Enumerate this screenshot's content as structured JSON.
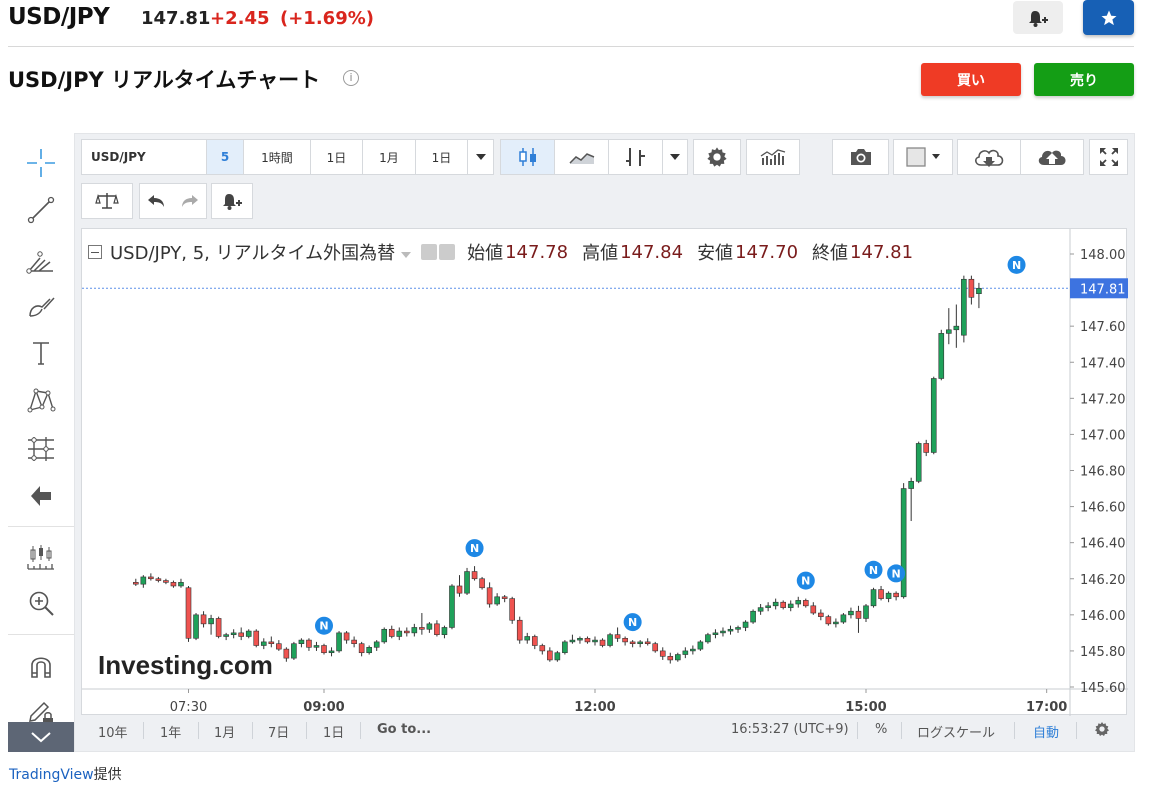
{
  "header": {
    "symbol": "USD/JPY",
    "price": "147.81",
    "change": "+2.45",
    "change_pct": "(+1.69%)"
  },
  "page_title": "USD/JPY リアルタイムチャート",
  "buttons": {
    "buy": "買い",
    "sell": "売り"
  },
  "toolbar": {
    "symbol": "USD/JPY",
    "interval": "5",
    "timeframes": [
      "1時間",
      "1日",
      "1月",
      "1日"
    ]
  },
  "legend": {
    "title": "USD/JPY, 5, リアルタイム外国為替",
    "open_label": "始値",
    "open": "147.78",
    "high_label": "高値",
    "high": "147.84",
    "low_label": "安値",
    "low": "147.70",
    "close_label": "終値",
    "close": "147.81"
  },
  "watermark": "Investing.com",
  "bottom_bar": {
    "ranges": [
      "10年",
      "1年",
      "1月",
      "7日",
      "1日"
    ],
    "goto": "Go to...",
    "clock": "16:53:27 (UTC+9)",
    "percent": "%",
    "log_scale": "ログスケール",
    "auto": "自動"
  },
  "credit": {
    "brand": "TradingView",
    "suffix": "提供"
  },
  "colors": {
    "up": "#26a69a",
    "up_fill": "#1fa15a",
    "down": "#ef5350",
    "accent_blue": "#1760b5",
    "last_price_tag": "#3d73e0"
  },
  "chart_data": {
    "type": "candlestick",
    "interval_minutes": 5,
    "y_ticks": [
      "148.00",
      "147.80",
      "147.60",
      "147.40",
      "147.20",
      "147.00",
      "146.80",
      "146.60",
      "146.40",
      "146.20",
      "146.00",
      "145.80",
      "145.60"
    ],
    "ylim": [
      145.55,
      148.1
    ],
    "x_ticks": [
      "07:30",
      "09:00",
      "12:00",
      "15:00",
      "17:00"
    ],
    "last_price": "147.81",
    "news_markers_times": [
      "09:00",
      "10:40",
      "12:25",
      "14:20",
      "15:05",
      "15:20",
      "16:40"
    ],
    "candles": [
      {
        "t": "06:55",
        "o": 146.18,
        "h": 146.2,
        "l": 146.16,
        "c": 146.17
      },
      {
        "t": "07:00",
        "o": 146.17,
        "h": 146.22,
        "l": 146.15,
        "c": 146.21
      },
      {
        "t": "07:05",
        "o": 146.21,
        "h": 146.23,
        "l": 146.19,
        "c": 146.2
      },
      {
        "t": "07:10",
        "o": 146.2,
        "h": 146.21,
        "l": 146.18,
        "c": 146.19
      },
      {
        "t": "07:15",
        "o": 146.19,
        "h": 146.2,
        "l": 146.17,
        "c": 146.18
      },
      {
        "t": "07:20",
        "o": 146.18,
        "h": 146.19,
        "l": 146.15,
        "c": 146.16
      },
      {
        "t": "07:25",
        "o": 146.16,
        "h": 146.2,
        "l": 146.15,
        "c": 146.18
      },
      {
        "t": "07:30",
        "o": 146.15,
        "h": 146.16,
        "l": 145.85,
        "c": 145.87
      },
      {
        "t": "07:35",
        "o": 145.87,
        "h": 146.01,
        "l": 145.86,
        "c": 146.0
      },
      {
        "t": "07:40",
        "o": 146.0,
        "h": 146.02,
        "l": 145.93,
        "c": 145.95
      },
      {
        "t": "07:45",
        "o": 145.95,
        "h": 146.0,
        "l": 145.89,
        "c": 145.98
      },
      {
        "t": "07:50",
        "o": 145.98,
        "h": 145.99,
        "l": 145.87,
        "c": 145.88
      },
      {
        "t": "07:55",
        "o": 145.88,
        "h": 145.9,
        "l": 145.86,
        "c": 145.89
      },
      {
        "t": "08:00",
        "o": 145.89,
        "h": 145.92,
        "l": 145.87,
        "c": 145.9
      },
      {
        "t": "08:05",
        "o": 145.9,
        "h": 145.93,
        "l": 145.86,
        "c": 145.88
      },
      {
        "t": "08:10",
        "o": 145.88,
        "h": 145.92,
        "l": 145.87,
        "c": 145.91
      },
      {
        "t": "08:15",
        "o": 145.91,
        "h": 145.92,
        "l": 145.82,
        "c": 145.83
      },
      {
        "t": "08:20",
        "o": 145.83,
        "h": 145.87,
        "l": 145.81,
        "c": 145.85
      },
      {
        "t": "08:25",
        "o": 145.85,
        "h": 145.88,
        "l": 145.82,
        "c": 145.84
      },
      {
        "t": "08:30",
        "o": 145.84,
        "h": 145.86,
        "l": 145.8,
        "c": 145.81
      },
      {
        "t": "08:35",
        "o": 145.81,
        "h": 145.82,
        "l": 145.74,
        "c": 145.76
      },
      {
        "t": "08:40",
        "o": 145.76,
        "h": 145.85,
        "l": 145.75,
        "c": 145.84
      },
      {
        "t": "08:45",
        "o": 145.84,
        "h": 145.87,
        "l": 145.82,
        "c": 145.86
      },
      {
        "t": "08:50",
        "o": 145.86,
        "h": 145.87,
        "l": 145.8,
        "c": 145.82
      },
      {
        "t": "08:55",
        "o": 145.82,
        "h": 145.85,
        "l": 145.8,
        "c": 145.83
      },
      {
        "t": "09:00",
        "o": 145.83,
        "h": 145.84,
        "l": 145.78,
        "c": 145.79
      },
      {
        "t": "09:05",
        "o": 145.79,
        "h": 145.82,
        "l": 145.77,
        "c": 145.8
      },
      {
        "t": "09:10",
        "o": 145.8,
        "h": 145.91,
        "l": 145.79,
        "c": 145.9
      },
      {
        "t": "09:15",
        "o": 145.9,
        "h": 145.91,
        "l": 145.84,
        "c": 145.86
      },
      {
        "t": "09:20",
        "o": 145.86,
        "h": 145.88,
        "l": 145.82,
        "c": 145.84
      },
      {
        "t": "09:25",
        "o": 145.84,
        "h": 145.85,
        "l": 145.77,
        "c": 145.79
      },
      {
        "t": "09:30",
        "o": 145.79,
        "h": 145.83,
        "l": 145.78,
        "c": 145.82
      },
      {
        "t": "09:35",
        "o": 145.82,
        "h": 145.86,
        "l": 145.8,
        "c": 145.85
      },
      {
        "t": "09:40",
        "o": 145.85,
        "h": 145.93,
        "l": 145.84,
        "c": 145.92
      },
      {
        "t": "09:45",
        "o": 145.92,
        "h": 145.94,
        "l": 145.87,
        "c": 145.88
      },
      {
        "t": "09:50",
        "o": 145.88,
        "h": 145.93,
        "l": 145.86,
        "c": 145.91
      },
      {
        "t": "09:55",
        "o": 145.91,
        "h": 145.93,
        "l": 145.88,
        "c": 145.9
      },
      {
        "t": "10:00",
        "o": 145.9,
        "h": 145.95,
        "l": 145.88,
        "c": 145.93
      },
      {
        "t": "10:05",
        "o": 145.93,
        "h": 146.01,
        "l": 145.89,
        "c": 145.92
      },
      {
        "t": "10:10",
        "o": 145.92,
        "h": 145.96,
        "l": 145.9,
        "c": 145.95
      },
      {
        "t": "10:15",
        "o": 145.95,
        "h": 145.97,
        "l": 145.88,
        "c": 145.89
      },
      {
        "t": "10:20",
        "o": 145.89,
        "h": 145.94,
        "l": 145.87,
        "c": 145.93
      },
      {
        "t": "10:25",
        "o": 145.93,
        "h": 146.17,
        "l": 145.92,
        "c": 146.16
      },
      {
        "t": "10:30",
        "o": 146.16,
        "h": 146.22,
        "l": 146.1,
        "c": 146.12
      },
      {
        "t": "10:35",
        "o": 146.12,
        "h": 146.26,
        "l": 146.11,
        "c": 146.24
      },
      {
        "t": "10:40",
        "o": 146.24,
        "h": 146.27,
        "l": 146.19,
        "c": 146.2
      },
      {
        "t": "10:45",
        "o": 146.2,
        "h": 146.21,
        "l": 146.14,
        "c": 146.15
      },
      {
        "t": "10:50",
        "o": 146.15,
        "h": 146.18,
        "l": 146.04,
        "c": 146.06
      },
      {
        "t": "10:55",
        "o": 146.06,
        "h": 146.12,
        "l": 146.05,
        "c": 146.1
      },
      {
        "t": "11:00",
        "o": 146.1,
        "h": 146.11,
        "l": 146.07,
        "c": 146.09
      },
      {
        "t": "11:05",
        "o": 146.09,
        "h": 146.1,
        "l": 145.95,
        "c": 145.97
      },
      {
        "t": "11:10",
        "o": 145.97,
        "h": 145.99,
        "l": 145.84,
        "c": 145.86
      },
      {
        "t": "11:15",
        "o": 145.86,
        "h": 145.9,
        "l": 145.84,
        "c": 145.88
      },
      {
        "t": "11:20",
        "o": 145.88,
        "h": 145.89,
        "l": 145.81,
        "c": 145.83
      },
      {
        "t": "11:25",
        "o": 145.83,
        "h": 145.84,
        "l": 145.78,
        "c": 145.8
      },
      {
        "t": "11:30",
        "o": 145.8,
        "h": 145.82,
        "l": 145.74,
        "c": 145.75
      },
      {
        "t": "11:35",
        "o": 145.75,
        "h": 145.8,
        "l": 145.74,
        "c": 145.79
      },
      {
        "t": "11:40",
        "o": 145.79,
        "h": 145.86,
        "l": 145.78,
        "c": 145.85
      },
      {
        "t": "11:45",
        "o": 145.85,
        "h": 145.89,
        "l": 145.84,
        "c": 145.86
      },
      {
        "t": "11:50",
        "o": 145.86,
        "h": 145.88,
        "l": 145.84,
        "c": 145.87
      },
      {
        "t": "11:55",
        "o": 145.87,
        "h": 145.88,
        "l": 145.84,
        "c": 145.85
      },
      {
        "t": "12:00",
        "o": 145.85,
        "h": 145.88,
        "l": 145.83,
        "c": 145.86
      },
      {
        "t": "12:05",
        "o": 145.86,
        "h": 145.87,
        "l": 145.82,
        "c": 145.83
      },
      {
        "t": "12:10",
        "o": 145.83,
        "h": 145.9,
        "l": 145.82,
        "c": 145.89
      },
      {
        "t": "12:15",
        "o": 145.89,
        "h": 145.93,
        "l": 145.85,
        "c": 145.87
      },
      {
        "t": "12:20",
        "o": 145.87,
        "h": 145.88,
        "l": 145.83,
        "c": 145.85
      },
      {
        "t": "12:25",
        "o": 145.85,
        "h": 145.86,
        "l": 145.82,
        "c": 145.84
      },
      {
        "t": "12:30",
        "o": 145.84,
        "h": 145.86,
        "l": 145.82,
        "c": 145.85
      },
      {
        "t": "12:35",
        "o": 145.85,
        "h": 145.87,
        "l": 145.83,
        "c": 145.84
      },
      {
        "t": "12:40",
        "o": 145.84,
        "h": 145.85,
        "l": 145.79,
        "c": 145.8
      },
      {
        "t": "12:45",
        "o": 145.8,
        "h": 145.82,
        "l": 145.75,
        "c": 145.77
      },
      {
        "t": "12:50",
        "o": 145.77,
        "h": 145.79,
        "l": 145.73,
        "c": 145.75
      },
      {
        "t": "12:55",
        "o": 145.75,
        "h": 145.79,
        "l": 145.74,
        "c": 145.78
      },
      {
        "t": "13:00",
        "o": 145.78,
        "h": 145.82,
        "l": 145.76,
        "c": 145.8
      },
      {
        "t": "13:05",
        "o": 145.8,
        "h": 145.83,
        "l": 145.78,
        "c": 145.81
      },
      {
        "t": "13:10",
        "o": 145.81,
        "h": 145.86,
        "l": 145.8,
        "c": 145.85
      },
      {
        "t": "13:15",
        "o": 145.85,
        "h": 145.9,
        "l": 145.84,
        "c": 145.89
      },
      {
        "t": "13:20",
        "o": 145.89,
        "h": 145.92,
        "l": 145.87,
        "c": 145.9
      },
      {
        "t": "13:25",
        "o": 145.9,
        "h": 145.93,
        "l": 145.88,
        "c": 145.91
      },
      {
        "t": "13:30",
        "o": 145.91,
        "h": 145.94,
        "l": 145.89,
        "c": 145.92
      },
      {
        "t": "13:35",
        "o": 145.92,
        "h": 145.94,
        "l": 145.9,
        "c": 145.93
      },
      {
        "t": "13:40",
        "o": 145.93,
        "h": 145.97,
        "l": 145.91,
        "c": 145.96
      },
      {
        "t": "13:45",
        "o": 145.96,
        "h": 146.03,
        "l": 145.95,
        "c": 146.02
      },
      {
        "t": "13:50",
        "o": 146.02,
        "h": 146.06,
        "l": 146.0,
        "c": 146.04
      },
      {
        "t": "13:55",
        "o": 146.04,
        "h": 146.07,
        "l": 146.02,
        "c": 146.05
      },
      {
        "t": "14:00",
        "o": 146.05,
        "h": 146.09,
        "l": 146.03,
        "c": 146.07
      },
      {
        "t": "14:05",
        "o": 146.07,
        "h": 146.08,
        "l": 146.03,
        "c": 146.04
      },
      {
        "t": "14:10",
        "o": 146.04,
        "h": 146.08,
        "l": 146.02,
        "c": 146.06
      },
      {
        "t": "14:15",
        "o": 146.06,
        "h": 146.1,
        "l": 146.04,
        "c": 146.08
      },
      {
        "t": "14:20",
        "o": 146.08,
        "h": 146.09,
        "l": 146.04,
        "c": 146.05
      },
      {
        "t": "14:25",
        "o": 146.05,
        "h": 146.07,
        "l": 146.0,
        "c": 146.01
      },
      {
        "t": "14:30",
        "o": 146.01,
        "h": 146.03,
        "l": 145.97,
        "c": 145.99
      },
      {
        "t": "14:35",
        "o": 145.99,
        "h": 146.0,
        "l": 145.94,
        "c": 145.95
      },
      {
        "t": "14:40",
        "o": 145.95,
        "h": 145.98,
        "l": 145.93,
        "c": 145.96
      },
      {
        "t": "14:45",
        "o": 145.96,
        "h": 146.01,
        "l": 145.95,
        "c": 146.0
      },
      {
        "t": "14:50",
        "o": 146.0,
        "h": 146.04,
        "l": 145.98,
        "c": 146.02
      },
      {
        "t": "14:55",
        "o": 146.02,
        "h": 146.05,
        "l": 145.9,
        "c": 145.98
      },
      {
        "t": "15:00",
        "o": 145.98,
        "h": 146.06,
        "l": 145.96,
        "c": 146.05
      },
      {
        "t": "15:05",
        "o": 146.05,
        "h": 146.15,
        "l": 146.04,
        "c": 146.14
      },
      {
        "t": "15:10",
        "o": 146.14,
        "h": 146.16,
        "l": 146.08,
        "c": 146.09
      },
      {
        "t": "15:15",
        "o": 146.09,
        "h": 146.13,
        "l": 146.07,
        "c": 146.12
      },
      {
        "t": "15:20",
        "o": 146.12,
        "h": 146.13,
        "l": 146.08,
        "c": 146.1
      },
      {
        "t": "15:25",
        "o": 146.1,
        "h": 146.73,
        "l": 146.09,
        "c": 146.7
      },
      {
        "t": "15:30",
        "o": 146.7,
        "h": 146.76,
        "l": 146.52,
        "c": 146.74
      },
      {
        "t": "15:35",
        "o": 146.74,
        "h": 146.96,
        "l": 146.73,
        "c": 146.95
      },
      {
        "t": "15:40",
        "o": 146.95,
        "h": 146.97,
        "l": 146.88,
        "c": 146.9
      },
      {
        "t": "15:45",
        "o": 146.9,
        "h": 147.32,
        "l": 146.89,
        "c": 147.31
      },
      {
        "t": "15:50",
        "o": 147.31,
        "h": 147.58,
        "l": 147.3,
        "c": 147.56
      },
      {
        "t": "15:55",
        "o": 147.56,
        "h": 147.7,
        "l": 147.5,
        "c": 147.58
      },
      {
        "t": "16:00",
        "o": 147.58,
        "h": 147.72,
        "l": 147.48,
        "c": 147.6
      },
      {
        "t": "16:05",
        "o": 147.55,
        "h": 147.88,
        "l": 147.51,
        "c": 147.86
      },
      {
        "t": "16:10",
        "o": 147.86,
        "h": 147.88,
        "l": 147.72,
        "c": 147.76
      },
      {
        "t": "16:15",
        "o": 147.78,
        "h": 147.84,
        "l": 147.7,
        "c": 147.81
      }
    ]
  }
}
